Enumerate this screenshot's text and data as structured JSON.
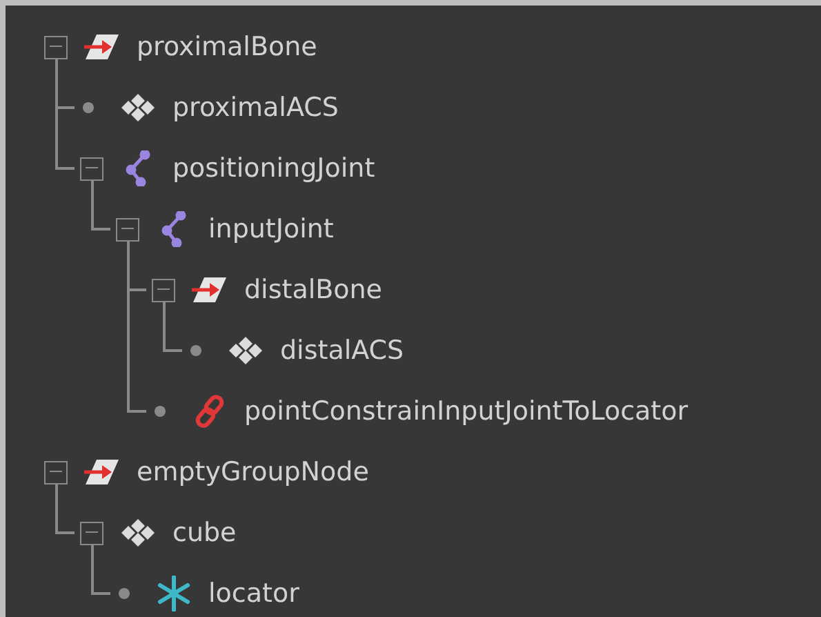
{
  "outliner": {
    "nodes": [
      {
        "name": "proximalBone",
        "kind": "group",
        "expanded": true,
        "children": [
          {
            "name": "proximalACS",
            "kind": "mesh"
          },
          {
            "name": "positioningJoint",
            "kind": "joint",
            "expanded": true,
            "children": [
              {
                "name": "inputJoint",
                "kind": "joint",
                "expanded": true,
                "children": [
                  {
                    "name": "distalBone",
                    "kind": "group",
                    "expanded": true,
                    "children": [
                      {
                        "name": "distalACS",
                        "kind": "mesh"
                      }
                    ]
                  },
                  {
                    "name": "pointConstrainInputJointToLocator",
                    "kind": "constraint"
                  }
                ]
              }
            ]
          }
        ]
      },
      {
        "name": "emptyGroupNode",
        "kind": "group",
        "expanded": true,
        "children": [
          {
            "name": "cube",
            "kind": "mesh",
            "expanded": true,
            "children": [
              {
                "name": "locator",
                "kind": "locator"
              }
            ]
          }
        ]
      }
    ]
  }
}
